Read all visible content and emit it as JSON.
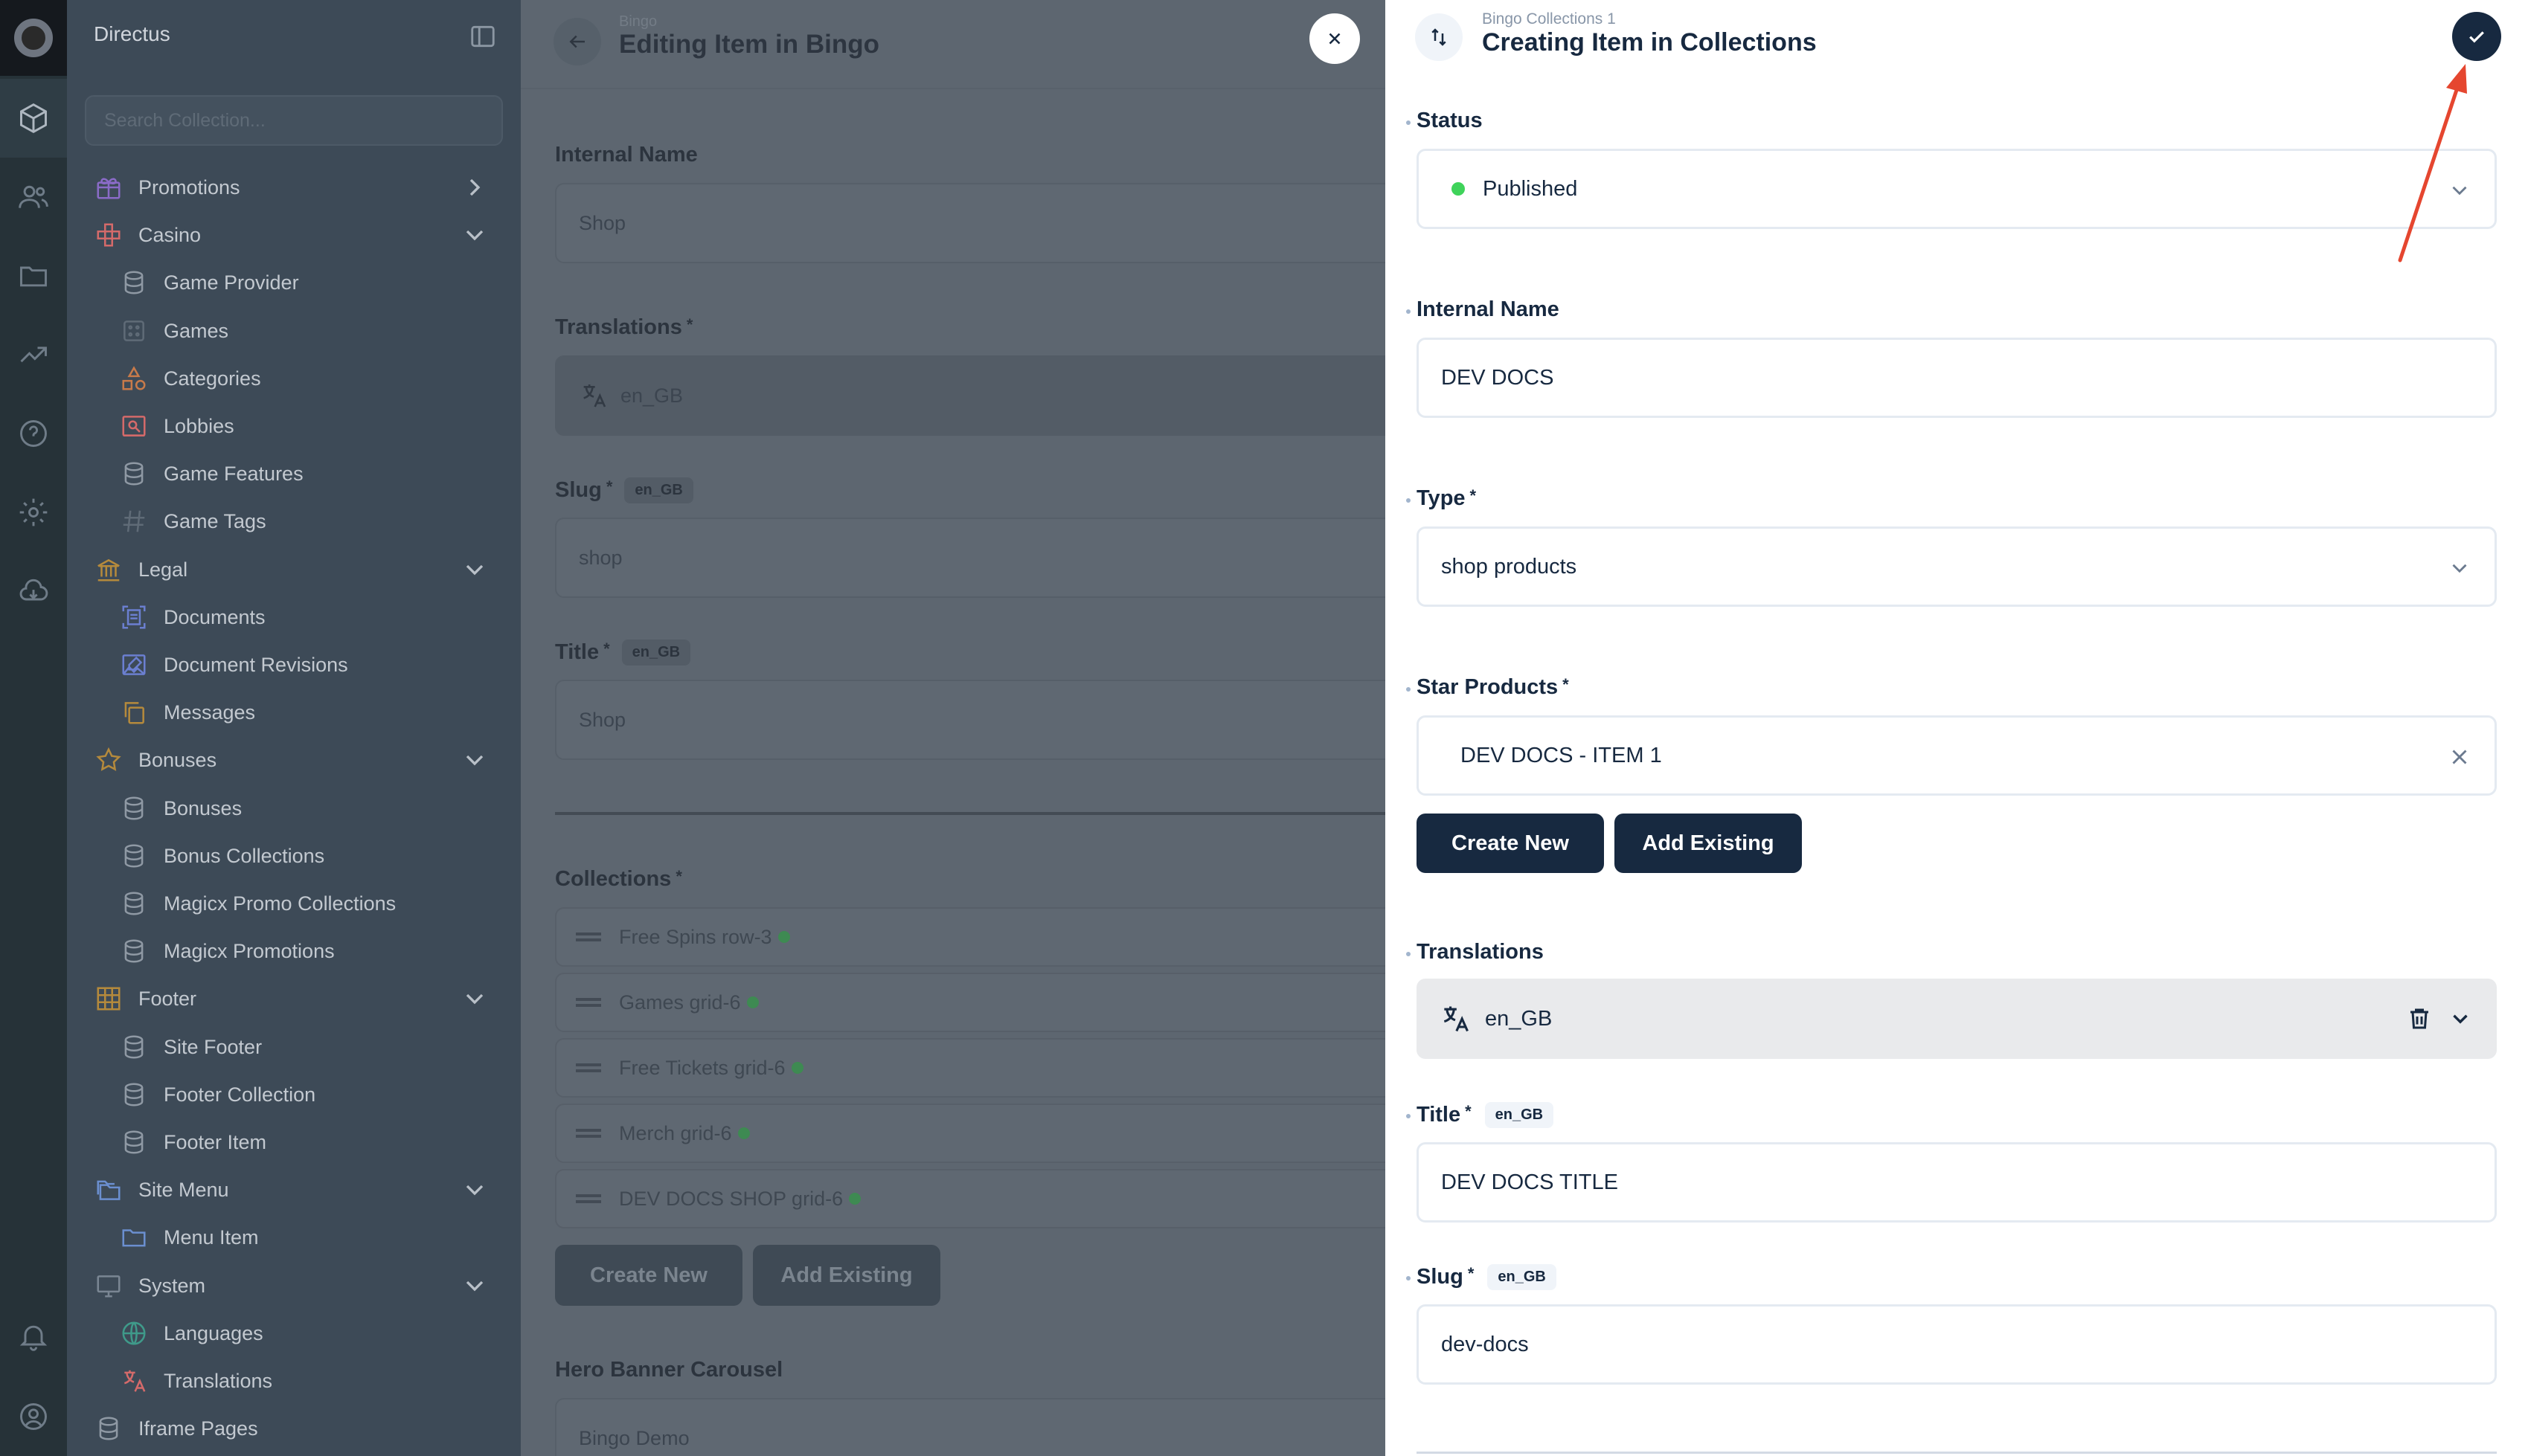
{
  "app": {
    "project_name": "Directus"
  },
  "module_bar": {
    "items": [
      "content-icon",
      "users-icon",
      "files-icon",
      "insights-icon",
      "help-icon",
      "settings-icon",
      "marketplace-icon",
      "notifications-icon",
      "user-profile-icon"
    ],
    "active": "content-icon"
  },
  "nav": {
    "search_placeholder": "Search Collection...",
    "items": [
      {
        "label": "Promotions",
        "icon": "gift-icon",
        "level": "group",
        "chevron": "right"
      },
      {
        "label": "Casino",
        "icon": "gamepad-icon",
        "level": "group",
        "chevron": "down"
      },
      {
        "label": "Game Provider",
        "icon": "database-icon",
        "level": "sub"
      },
      {
        "label": "Games",
        "icon": "dice-icon",
        "level": "sub"
      },
      {
        "label": "Categories",
        "icon": "shapes-icon",
        "level": "sub"
      },
      {
        "label": "Lobbies",
        "icon": "image-search-icon",
        "level": "sub"
      },
      {
        "label": "Game Features",
        "icon": "database-icon",
        "level": "sub"
      },
      {
        "label": "Game Tags",
        "icon": "hashtag-icon",
        "level": "sub"
      },
      {
        "label": "Legal",
        "icon": "bank-icon",
        "level": "group",
        "chevron": "down"
      },
      {
        "label": "Documents",
        "icon": "document-scan-icon",
        "level": "sub"
      },
      {
        "label": "Document Revisions",
        "icon": "edit-image-icon",
        "level": "sub"
      },
      {
        "label": "Messages",
        "icon": "copy-icon",
        "level": "sub"
      },
      {
        "label": "Bonuses",
        "icon": "star-icon",
        "level": "group",
        "chevron": "down"
      },
      {
        "label": "Bonuses",
        "icon": "database-icon",
        "level": "sub"
      },
      {
        "label": "Bonus Collections",
        "icon": "database-icon",
        "level": "sub"
      },
      {
        "label": "Magicx Promo Collections",
        "icon": "database-icon",
        "level": "sub"
      },
      {
        "label": "Magicx Promotions",
        "icon": "database-icon",
        "level": "sub"
      },
      {
        "label": "Footer",
        "icon": "grid-icon",
        "level": "group",
        "chevron": "down"
      },
      {
        "label": "Site Footer",
        "icon": "database-icon",
        "level": "sub"
      },
      {
        "label": "Footer Collection",
        "icon": "database-icon",
        "level": "sub"
      },
      {
        "label": "Footer Item",
        "icon": "database-icon",
        "level": "sub"
      },
      {
        "label": "Site Menu",
        "icon": "folders-icon",
        "level": "group",
        "chevron": "down"
      },
      {
        "label": "Menu Item",
        "icon": "folder-icon",
        "level": "sub"
      },
      {
        "label": "System",
        "icon": "monitor-icon",
        "level": "group",
        "chevron": "down"
      },
      {
        "label": "Languages",
        "icon": "globe-icon",
        "level": "sub"
      },
      {
        "label": "Translations",
        "icon": "translate-icon",
        "level": "sub"
      },
      {
        "label": "Iframe Pages",
        "icon": "database-icon",
        "level": "group"
      }
    ]
  },
  "editor": {
    "breadcrumb": "Bingo",
    "title": "Editing Item in Bingo",
    "internal_name_label": "Internal Name",
    "internal_name_value": "Shop",
    "translations_label": "Translations",
    "translations_value": "en_GB",
    "slug_label": "Slug",
    "slug_lang": "en_GB",
    "slug_value": "shop",
    "title_label": "Title",
    "title_lang": "en_GB",
    "title_value": "Shop",
    "collections_label": "Collections",
    "collections": [
      "Free Spins row-3",
      "Games grid-6",
      "Free Tickets grid-6",
      "Merch grid-6",
      "DEV DOCS SHOP grid-6"
    ],
    "create_new": "Create New",
    "add_existing": "Add Existing",
    "hero_label": "Hero Banner Carousel",
    "hero_value": "Bingo Demo"
  },
  "drawer": {
    "breadcrumb": "Bingo Collections 1",
    "title": "Creating Item in Collections",
    "status": {
      "label": "Status",
      "value": "Published",
      "dot_color": "#3fd35a"
    },
    "internal_name": {
      "label": "Internal Name",
      "value": "DEV DOCS"
    },
    "type": {
      "label": "Type",
      "value": "shop products"
    },
    "star_products": {
      "label": "Star Products",
      "item": "DEV DOCS - ITEM 1",
      "create_new": "Create New",
      "add_existing": "Add Existing"
    },
    "translations": {
      "label": "Translations",
      "value": "en_GB"
    },
    "title_field": {
      "label": "Title",
      "lang": "en_GB",
      "value": "DEV DOCS TITLE"
    },
    "slug_field": {
      "label": "Slug",
      "lang": "en_GB",
      "value": "dev-docs"
    },
    "required_mark": "*"
  },
  "colors": {
    "primary": "#172940",
    "annotation_arrow": "#e5462f",
    "published": "#3fd35a"
  }
}
